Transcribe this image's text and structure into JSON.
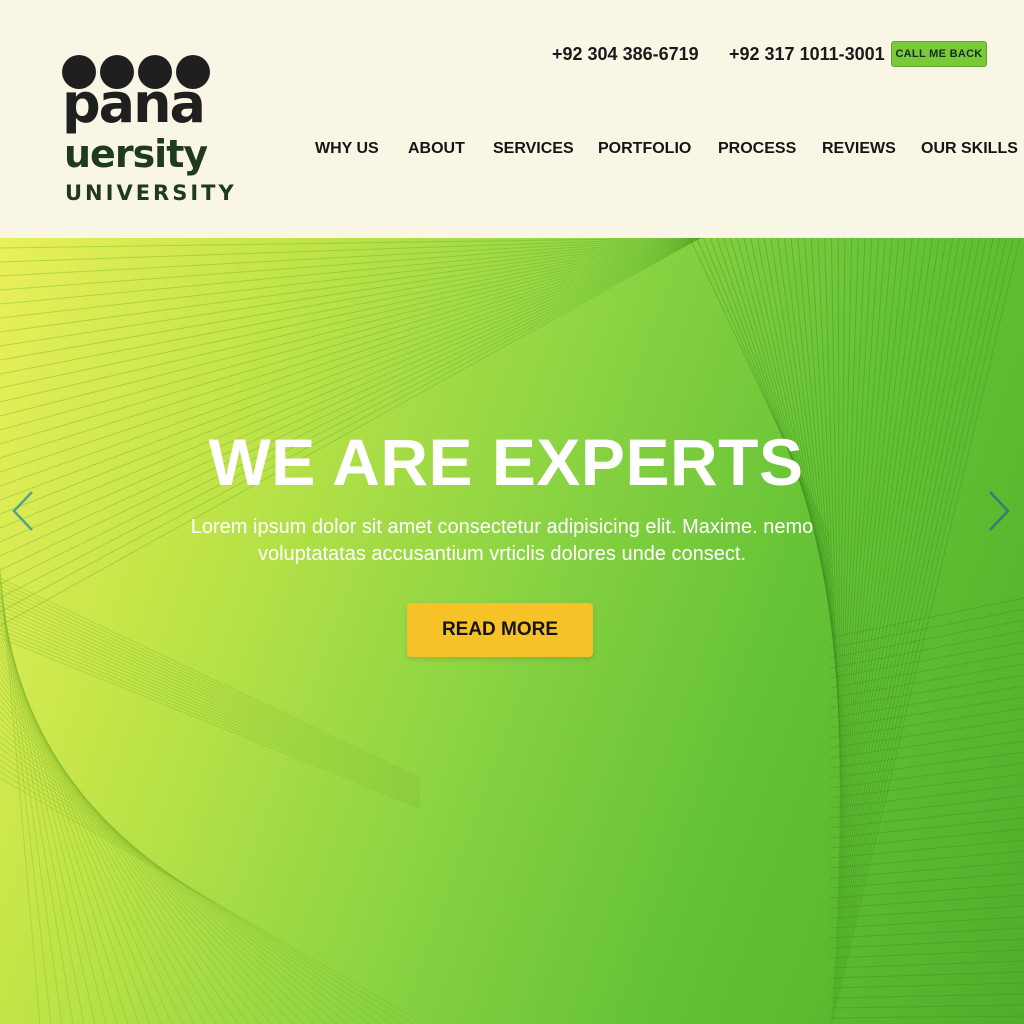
{
  "brand": {
    "line1": "pana",
    "line2": "uersity",
    "line3": "UNIVERSITY"
  },
  "contact": {
    "phone_1": "+92 304 386-6719",
    "phone_2": "+92 317 1011-3001",
    "call_me_back": "CALL ME BACK"
  },
  "nav": {
    "items": [
      {
        "label": "WHY US"
      },
      {
        "label": "ABOUT"
      },
      {
        "label": "SERVICES"
      },
      {
        "label": "PORTFOLIO"
      },
      {
        "label": "PROCESS"
      },
      {
        "label": "REVIEWS"
      },
      {
        "label": "OUR SKILLS"
      }
    ]
  },
  "hero": {
    "title": "WE ARE EXPERTS",
    "text": "Lorem ipsum dolor sit amet consectetur adipisicing elit. Maxime. nemo voluptatatas accusantium vrticlis dolores unde consect.",
    "button": "READ MORE",
    "prev_icon": "chevron-left-icon",
    "next_icon": "chevron-right-icon"
  },
  "colors": {
    "header_bg": "#faf6e6",
    "accent_green": "#7cc83b",
    "button_yellow": "#f7c228",
    "hero_gradient_start": "#eaf05a",
    "hero_gradient_end": "#4fae2a"
  }
}
